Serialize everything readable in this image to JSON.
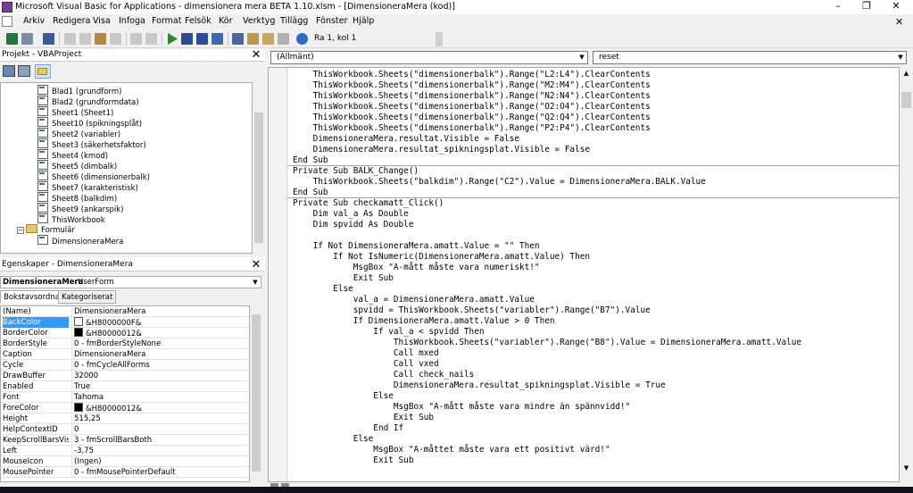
{
  "window": {
    "title": "Microsoft Visual Basic for Applications - dimensionera mera BETA 1.10.xlsm - [DimensioneraMera (kod)]",
    "minimize_glyph": "–",
    "restore_glyph": "❐",
    "close_glyph": "✕"
  },
  "menu": [
    "Arkiv",
    "Redigera",
    "Visa",
    "Infoga",
    "Format",
    "Felsök",
    "Kör",
    "Verktyg",
    "Tillägg",
    "Fönster",
    "Hjälp"
  ],
  "menu_close_glyph": "✕",
  "toolbar": {
    "cursor_position": "Ra 1, kol 1"
  },
  "project": {
    "title": "Projekt - VBAProject",
    "items": [
      "Blad1 (grundform)",
      "Blad2 (grundformdata)",
      "Sheet1 (Sheet1)",
      "Sheet10 (spikningsplåt)",
      "Sheet2 (variabler)",
      "Sheet3 (säkerhetsfaktor)",
      "Sheet4 (kmod)",
      "Sheet5 (dimbalk)",
      "Sheet6 (dimensionerbalk)",
      "Sheet7 (karakteristisk)",
      "Sheet8 (balkdim)",
      "Sheet9 (ankarspik)",
      "ThisWorkbook"
    ],
    "folder": "Formulär",
    "form": "DimensioneraMera"
  },
  "properties": {
    "title": "Egenskaper - DimensioneraMera",
    "object_name": "DimensioneraMera",
    "object_type": "UserForm",
    "tabs": [
      "Bokstavsordnat",
      "Kategoriserat"
    ],
    "rows": [
      {
        "name": "(Name)",
        "value": "DimensioneraMera"
      },
      {
        "name": "BackColor",
        "value": "&H8000000F&",
        "swatch": "#ffffff"
      },
      {
        "name": "BorderColor",
        "value": "&H80000012&",
        "swatch": "#000000"
      },
      {
        "name": "BorderStyle",
        "value": "0 - fmBorderStyleNone"
      },
      {
        "name": "Caption",
        "value": "DimensioneraMera"
      },
      {
        "name": "Cycle",
        "value": "0 - fmCycleAllForms"
      },
      {
        "name": "DrawBuffer",
        "value": "32000"
      },
      {
        "name": "Enabled",
        "value": "True"
      },
      {
        "name": "Font",
        "value": "Tahoma"
      },
      {
        "name": "ForeColor",
        "value": "&H80000012&",
        "swatch": "#000000"
      },
      {
        "name": "Height",
        "value": "515,25"
      },
      {
        "name": "HelpContextID",
        "value": "0"
      },
      {
        "name": "KeepScrollBarsVisible",
        "value": "3 - fmScrollBarsBoth"
      },
      {
        "name": "Left",
        "value": "-3,75"
      },
      {
        "name": "MouseIcon",
        "value": "(Ingen)"
      },
      {
        "name": "MousePointer",
        "value": "0 - fmMousePointerDefault"
      }
    ]
  },
  "code": {
    "object_combo": "(Allmänt)",
    "procedure_combo": "reset",
    "lines": [
      "    ThisWorkbook.Sheets(\"dimensionerbalk\").Range(\"L2:L4\").ClearContents",
      "    ThisWorkbook.Sheets(\"dimensionerbalk\").Range(\"M2:M4\").ClearContents",
      "    ThisWorkbook.Sheets(\"dimensionerbalk\").Range(\"N2:N4\").ClearContents",
      "    ThisWorkbook.Sheets(\"dimensionerbalk\").Range(\"O2:O4\").ClearContents",
      "    ThisWorkbook.Sheets(\"dimensionerbalk\").Range(\"Q2:Q4\").ClearContents",
      "    ThisWorkbook.Sheets(\"dimensionerbalk\").Range(\"P2:P4\").ClearContents",
      "    DimensioneraMera.resultat.Visible = False",
      "    DimensioneraMera.resultat_spikningsplat.Visible = False",
      "End Sub",
      "Private Sub BALK_Change()",
      "    ThisWorkbook.Sheets(\"balkdim\").Range(\"C2\").Value = DimensioneraMera.BALK.Value",
      "End Sub",
      "Private Sub checkamatt_Click()",
      "    Dim val_a As Double",
      "    Dim spvidd As Double",
      "",
      "    If Not DimensioneraMera.amatt.Value = \"\" Then",
      "        If Not IsNumeric(DimensioneraMera.amatt.Value) Then",
      "            MsgBox \"A-mått måste vara numeriskt!\"",
      "            Exit Sub",
      "        Else",
      "            val_a = DimensioneraMera.amatt.Value",
      "            spvidd = ThisWorkbook.Sheets(\"variabler\").Range(\"B7\").Value",
      "            If DimensioneraMera.amatt.Value > 0 Then",
      "                If val_a < spvidd Then",
      "                    ThisWorkbook.Sheets(\"variabler\").Range(\"B8\").Value = DimensioneraMera.amatt.Value",
      "                    Call mxed",
      "                    Call vxed",
      "                    Call check_nails",
      "                    DimensioneraMera.resultat_spikningsplat.Visible = True",
      "                Else",
      "                    MsgBox \"A-mått måste vara mindre än spännvidd!\"",
      "                    Exit Sub",
      "                End If",
      "            Else",
      "                MsgBox \"A-måttet måste vara ett positivt värd!\"",
      "                Exit Sub"
    ]
  }
}
